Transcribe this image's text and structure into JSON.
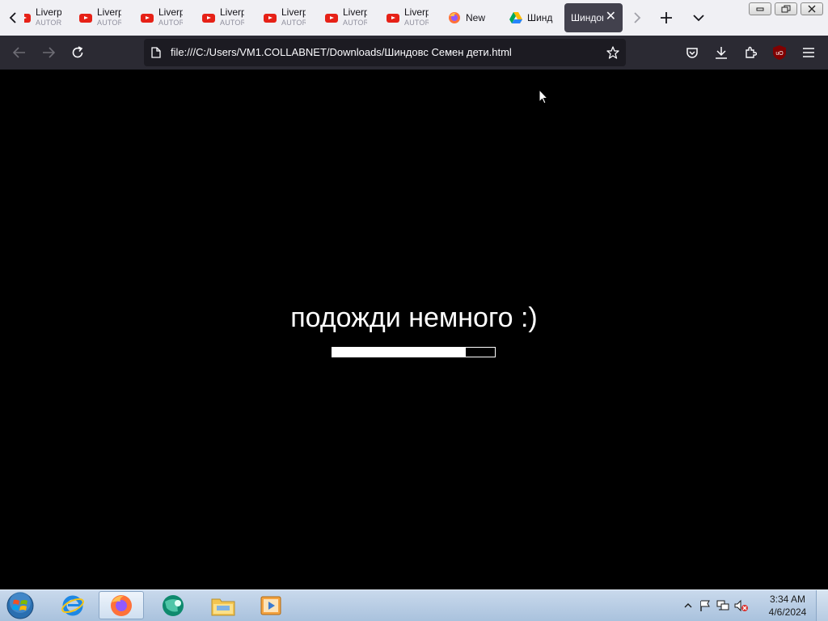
{
  "tabs": [
    {
      "title": "Liverp",
      "subtitle": "AUTOR",
      "icon": "youtube-icon"
    },
    {
      "title": "Liverp",
      "subtitle": "AUTOR",
      "icon": "youtube-icon"
    },
    {
      "title": "Liverp",
      "subtitle": "AUTOR",
      "icon": "youtube-icon"
    },
    {
      "title": "Liverp",
      "subtitle": "AUTOR",
      "icon": "youtube-icon"
    },
    {
      "title": "Liverp",
      "subtitle": "AUTOR",
      "icon": "youtube-icon"
    },
    {
      "title": "Liverp",
      "subtitle": "AUTOR",
      "icon": "youtube-icon"
    },
    {
      "title": "Liverp",
      "subtitle": "AUTOR",
      "icon": "youtube-icon"
    },
    {
      "title": "New T",
      "icon": "firefox-icon"
    },
    {
      "title": "Шинд",
      "icon": "google-drive-icon"
    }
  ],
  "active_tab": {
    "title": "Шиндов"
  },
  "url": "file:///C:/Users/VM1.COLLABNET/Downloads/Шиндовс Семен дети.html",
  "page": {
    "message": "подожди немного :)",
    "progress": 0.82
  },
  "taskbar": {
    "apps": [
      "internet-explorer-icon",
      "firefox-icon",
      "app-globe-icon",
      "file-explorer-icon",
      "media-player-icon"
    ],
    "clock_time": "3:34 AM",
    "clock_date": "4/6/2024"
  },
  "colors": {
    "tabstrip": "#f0f0f4",
    "navbar": "#2b2a33",
    "urlbar": "#1c1b22",
    "page_bg": "#000000",
    "youtube_red": "#e62117"
  }
}
